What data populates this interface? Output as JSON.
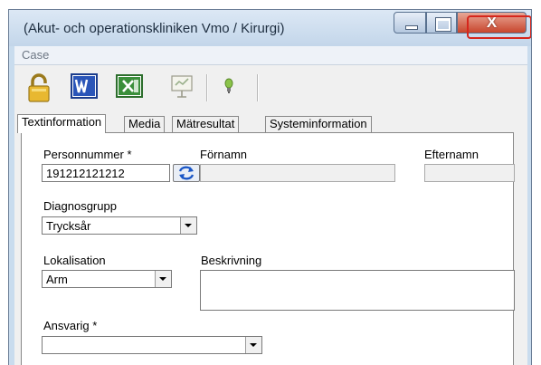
{
  "window": {
    "title": "(Akut- och operationskliniken Vmo / Kirurgi)",
    "close_glyph": "X",
    "colors": {
      "titlebar": "#c9dcee",
      "close": "#c8452c",
      "highlight": "#d6261c"
    }
  },
  "menu": {
    "items": [
      "Case"
    ]
  },
  "toolbar": {
    "icons": [
      "lock-icon",
      "word-icon",
      "excel-icon",
      "presentation-icon",
      "lightbulb-icon"
    ]
  },
  "tabs": [
    "Textinformation",
    "Media",
    "Mätresultat",
    "Systeminformation"
  ],
  "form": {
    "personnummer": {
      "label": "Personnummer *",
      "value": "191212121212"
    },
    "fornamn": {
      "label": "Förnamn",
      "value": ""
    },
    "efternamn": {
      "label": "Efternamn",
      "value": ""
    },
    "diagnosgrupp": {
      "label": "Diagnosgrupp",
      "value": "Trycksår"
    },
    "lokalisation": {
      "label": "Lokalisation",
      "value": "Arm"
    },
    "beskrivning": {
      "label": "Beskrivning",
      "value": ""
    },
    "ansvarig": {
      "label": "Ansvarig *",
      "value": ""
    }
  }
}
